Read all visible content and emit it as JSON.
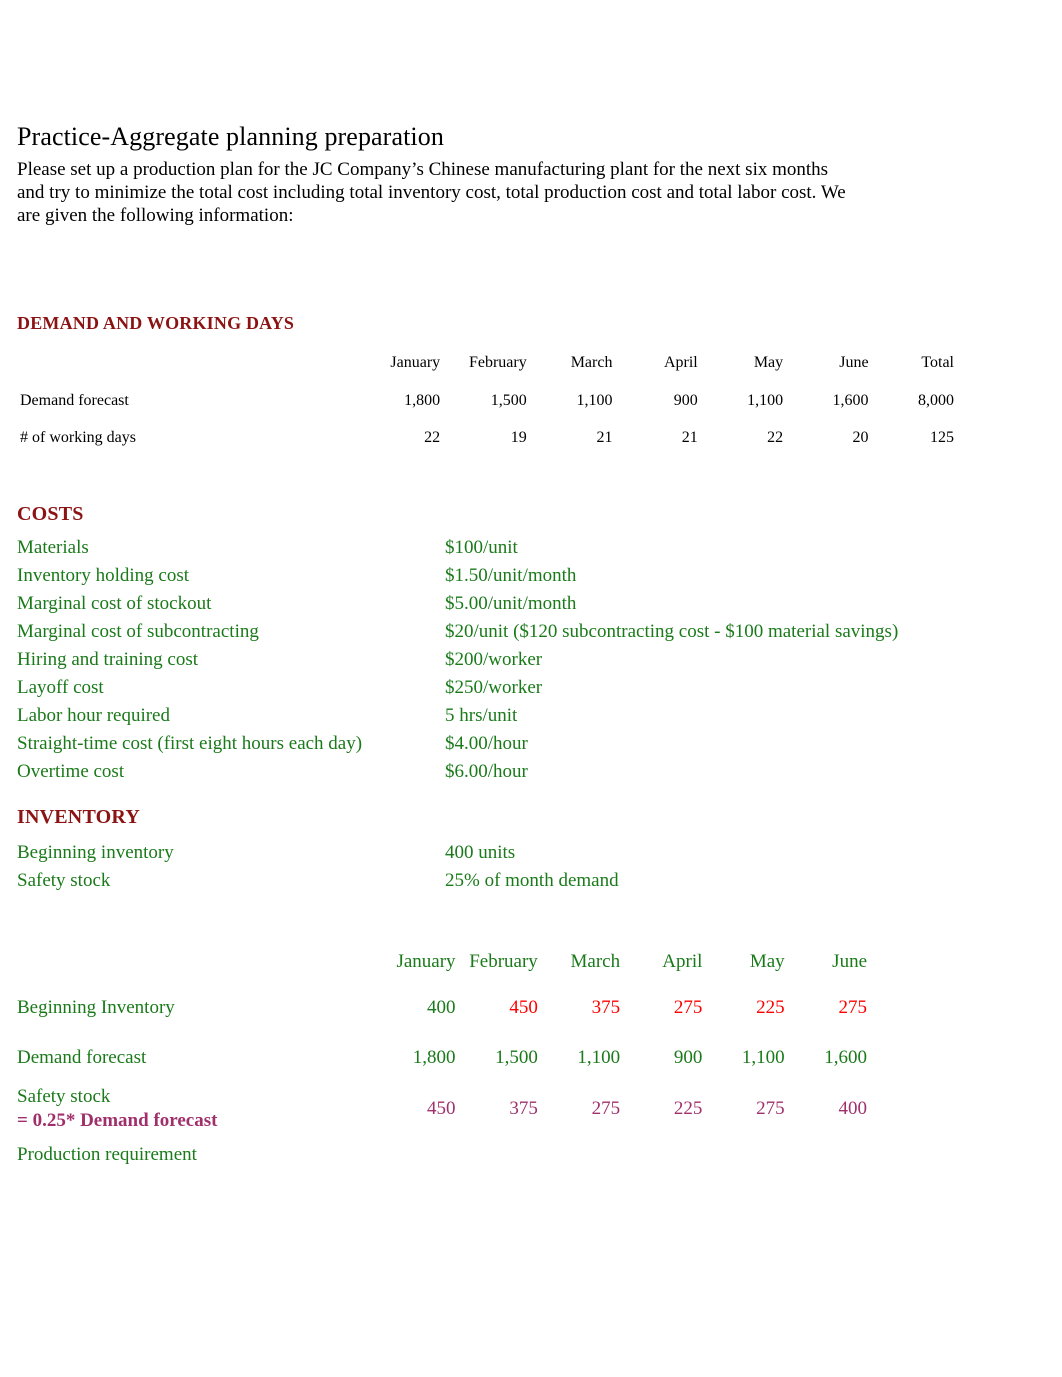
{
  "document": {
    "title": "Practice-Aggregate planning preparation",
    "intro": "Please set up a production plan for the JC Company’s Chinese manufacturing plant for the next six months and try to minimize the total cost including total inventory cost, total production cost and total labor cost. We are given the following information:"
  },
  "colors": {
    "heading": "#8B1313",
    "body_green": "#1A7A1A",
    "highlight_red": "#FF0000",
    "highlight_purple": "#A0306B",
    "title_black": "#000000"
  },
  "demand_section": {
    "heading": "DEMAND AND WORKING DAYS",
    "columns": [
      "January",
      "February",
      "March",
      "April",
      "May",
      "June",
      "Total"
    ],
    "rows": [
      {
        "label": "Demand forecast",
        "values": [
          "1,800",
          "1,500",
          "1,100",
          "900",
          "1,100",
          "1,600",
          "8,000"
        ]
      },
      {
        "label": "# of working days",
        "values": [
          "22",
          "19",
          "21",
          "21",
          "22",
          "20",
          "125"
        ]
      }
    ]
  },
  "costs_section": {
    "heading": "COSTS",
    "items": [
      {
        "name": "Materials",
        "value": "$100/unit"
      },
      {
        "name": "Inventory holding cost",
        "value": "$1.50/unit/month"
      },
      {
        "name": "Marginal cost of stockout",
        "value": "$5.00/unit/month"
      },
      {
        "name": "Marginal cost of subcontracting",
        "value": "$20/unit ($120 subcontracting cost - $100 material savings)"
      },
      {
        "name": "Hiring and training cost",
        "value": "$200/worker"
      },
      {
        "name": "Layoff cost",
        "value": "$250/worker"
      },
      {
        "name": "Labor hour required",
        "value": "5 hrs/unit"
      },
      {
        "name": "Straight-time cost (first eight hours each day)",
        "value": "$4.00/hour"
      },
      {
        "name": "Overtime cost",
        "value": "$6.00/hour"
      }
    ]
  },
  "inventory_section": {
    "heading": "INVENTORY",
    "items": [
      {
        "name": "Beginning inventory",
        "value": "400 units"
      },
      {
        "name": "Safety stock",
        "value": "25% of month demand"
      }
    ]
  },
  "plan_section": {
    "columns": [
      "January",
      "February",
      "March",
      "April",
      "May",
      "June"
    ],
    "rows": [
      {
        "label": "Beginning Inventory",
        "label_line2": "",
        "values": [
          "400",
          "450",
          "375",
          "275",
          "225",
          "275"
        ],
        "value_styles": [
          "g",
          "red-bold",
          "red-bold",
          "red-bold",
          "red-bold",
          "red-bold"
        ]
      },
      {
        "label": "Demand forecast",
        "label_line2": "",
        "values": [
          "1,800",
          "1,500",
          "1,100",
          "900",
          "1,100",
          "1,600"
        ],
        "value_styles": [
          "g",
          "g",
          "g",
          "g",
          "g",
          "g"
        ]
      },
      {
        "label": "Safety stock",
        "label_line2": "= 0.25* Demand forecast",
        "values": [
          "450",
          "375",
          "275",
          "225",
          "275",
          "400"
        ],
        "value_styles": [
          "purple-bold",
          "purple-bold",
          "purple-bold",
          "purple-bold",
          "purple-bold",
          "purple-bold"
        ]
      },
      {
        "label": "Production requirement",
        "label_line2": "",
        "values": [
          "",
          "",
          "",
          "",
          "",
          ""
        ],
        "value_styles": [
          "g",
          "g",
          "g",
          "g",
          "g",
          "g"
        ]
      }
    ]
  }
}
